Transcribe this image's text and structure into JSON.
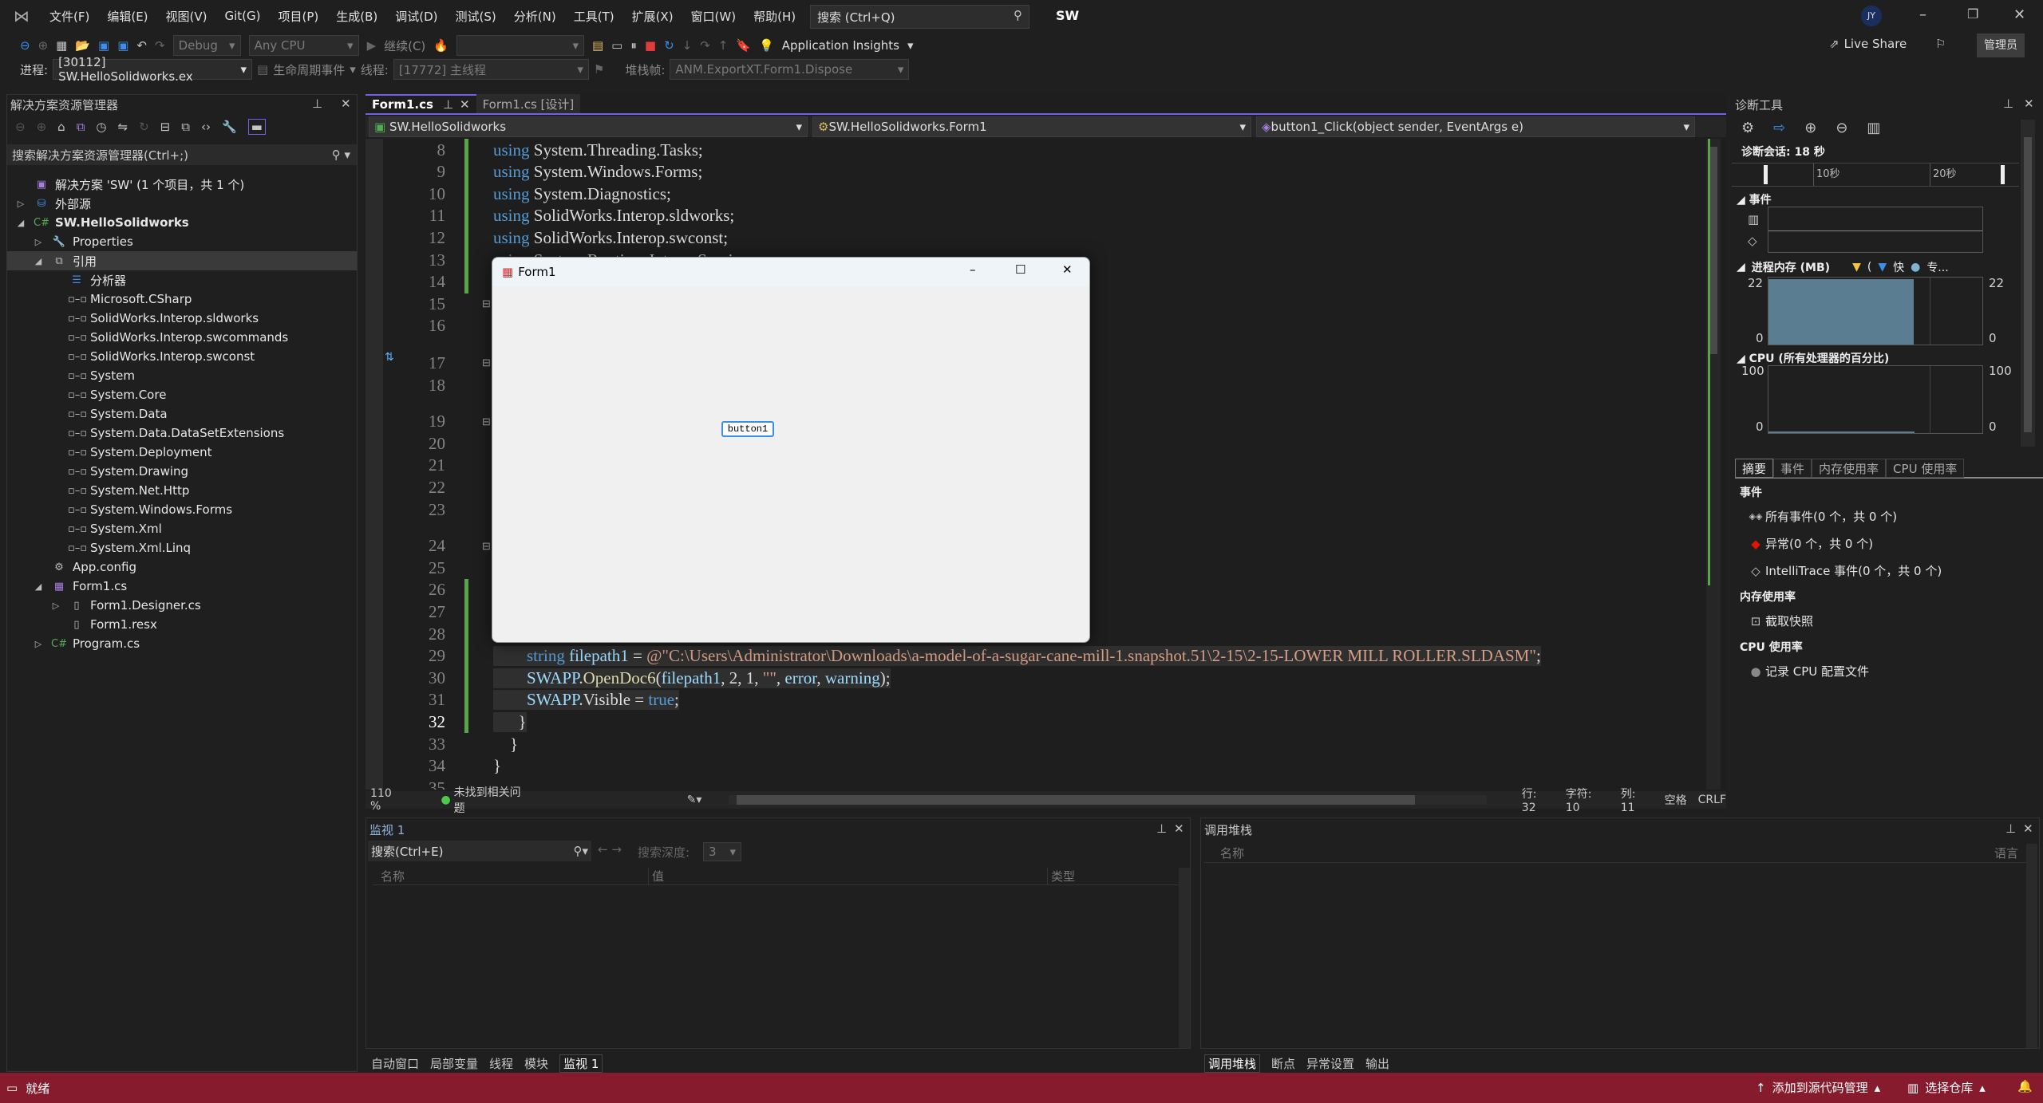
{
  "titlebar": {
    "menus": [
      "文件(F)",
      "编辑(E)",
      "视图(V)",
      "Git(G)",
      "项目(P)",
      "生成(B)",
      "调试(D)",
      "测试(S)",
      "分析(N)",
      "工具(T)",
      "扩展(X)",
      "窗口(W)",
      "帮助(H)"
    ],
    "search_placeholder": "搜索 (Ctrl+Q)",
    "solution_name": "SW",
    "avatar": "JY"
  },
  "toolbar": {
    "config": "Debug",
    "platform": "Any CPU",
    "continue": "继续(C)",
    "app_insights": "Application Insights",
    "live_share": "Live Share",
    "admin": "管理员",
    "process_label": "进程:",
    "process": "[30112] SW.HelloSolidworks.ex",
    "lifecycle": "生命周期事件",
    "thread_label": "线程:",
    "thread": "[17772] 主线程",
    "stackframe_label": "堆栈帧:",
    "stackframe": "ANM.ExportXT.Form1.Dispose"
  },
  "solution_explorer": {
    "title": "解决方案资源管理器",
    "search_placeholder": "搜索解决方案资源管理器(Ctrl+;)",
    "items": [
      {
        "label": "解决方案 'SW' (1 个项目，共 1 个)",
        "level": 0,
        "icon": "solution-icon",
        "expander": ""
      },
      {
        "label": "外部源",
        "level": 0,
        "icon": "external-sources-icon",
        "expander": "collapsed"
      },
      {
        "label": "SW.HelloSolidworks",
        "level": 0,
        "icon": "csharp-project-icon",
        "expander": "expanded",
        "bold": true
      },
      {
        "label": "Properties",
        "level": 1,
        "icon": "wrench-icon",
        "expander": "collapsed"
      },
      {
        "label": "引用",
        "level": 1,
        "icon": "references-icon",
        "expander": "expanded",
        "selected": true
      },
      {
        "label": "分析器",
        "level": 2,
        "icon": "analyzer-icon",
        "expander": ""
      },
      {
        "label": "Microsoft.CSharp",
        "level": 2,
        "icon": "reference-icon",
        "expander": ""
      },
      {
        "label": "SolidWorks.Interop.sldworks",
        "level": 2,
        "icon": "reference-icon",
        "expander": ""
      },
      {
        "label": "SolidWorks.Interop.swcommands",
        "level": 2,
        "icon": "reference-icon",
        "expander": ""
      },
      {
        "label": "SolidWorks.Interop.swconst",
        "level": 2,
        "icon": "reference-icon",
        "expander": ""
      },
      {
        "label": "System",
        "level": 2,
        "icon": "reference-icon",
        "expander": ""
      },
      {
        "label": "System.Core",
        "level": 2,
        "icon": "reference-icon",
        "expander": ""
      },
      {
        "label": "System.Data",
        "level": 2,
        "icon": "reference-icon",
        "expander": ""
      },
      {
        "label": "System.Data.DataSetExtensions",
        "level": 2,
        "icon": "reference-icon",
        "expander": ""
      },
      {
        "label": "System.Deployment",
        "level": 2,
        "icon": "reference-icon",
        "expander": ""
      },
      {
        "label": "System.Drawing",
        "level": 2,
        "icon": "reference-icon",
        "expander": ""
      },
      {
        "label": "System.Net.Http",
        "level": 2,
        "icon": "reference-icon",
        "expander": ""
      },
      {
        "label": "System.Windows.Forms",
        "level": 2,
        "icon": "reference-icon",
        "expander": ""
      },
      {
        "label": "System.Xml",
        "level": 2,
        "icon": "reference-icon",
        "expander": ""
      },
      {
        "label": "System.Xml.Linq",
        "level": 2,
        "icon": "reference-icon",
        "expander": ""
      },
      {
        "label": "App.config",
        "level": 1,
        "icon": "config-icon",
        "expander": ""
      },
      {
        "label": "Form1.cs",
        "level": 1,
        "icon": "form-icon",
        "expander": "expanded"
      },
      {
        "label": "Form1.Designer.cs",
        "level": 2,
        "icon": "file-icon",
        "expander": "collapsed"
      },
      {
        "label": "Form1.resx",
        "level": 2,
        "icon": "file-icon",
        "expander": ""
      },
      {
        "label": "Program.cs",
        "level": 1,
        "icon": "csharp-file-icon",
        "expander": "collapsed"
      }
    ]
  },
  "editor": {
    "tabs": [
      {
        "label": "Form1.cs",
        "active": true
      },
      {
        "label": "Form1.cs [设计]",
        "active": false
      }
    ],
    "nav": {
      "project": "SW.HelloSolidworks",
      "class": "SW.HelloSolidworks.Form1",
      "member": "button1_Click(object sender, EventArgs e)"
    },
    "lines": [
      {
        "n": 8,
        "tokens": [
          {
            "t": "using",
            "c": "kw"
          },
          {
            "t": " System.Threading.Tasks;",
            "c": "id"
          }
        ]
      },
      {
        "n": 9,
        "tokens": [
          {
            "t": "using",
            "c": "kw"
          },
          {
            "t": " System.Windows.Forms;",
            "c": "id"
          }
        ]
      },
      {
        "n": 10,
        "tokens": [
          {
            "t": "using",
            "c": "kw"
          },
          {
            "t": " System.Diagnostics;",
            "c": "id"
          }
        ]
      },
      {
        "n": 11,
        "tokens": [
          {
            "t": "using",
            "c": "kw"
          },
          {
            "t": " SolidWorks.Interop.sldworks;",
            "c": "id"
          }
        ]
      },
      {
        "n": 12,
        "tokens": [
          {
            "t": "using",
            "c": "kw"
          },
          {
            "t": " SolidWorks.Interop.swconst;",
            "c": "id"
          }
        ]
      },
      {
        "n": 13,
        "tokens": [
          {
            "t": "using",
            "c": "kw"
          },
          {
            "t": " System.Runtime.InteropServices;",
            "c": "id"
          }
        ]
      },
      {
        "n": 14,
        "tokens": []
      },
      {
        "n": 15,
        "tokens": []
      },
      {
        "n": 16,
        "tokens": []
      },
      {
        "n": 17,
        "tokens": []
      },
      {
        "n": 18,
        "tokens": []
      },
      {
        "n": 19,
        "tokens": []
      },
      {
        "n": 20,
        "tokens": []
      },
      {
        "n": 21,
        "tokens": []
      },
      {
        "n": 22,
        "tokens": []
      },
      {
        "n": 23,
        "tokens": []
      },
      {
        "n": 24,
        "tokens": []
      },
      {
        "n": 25,
        "tokens": []
      },
      {
        "n": 26,
        "tokens": []
      },
      {
        "n": 27,
        "tokens": []
      },
      {
        "n": 28,
        "tokens": []
      },
      {
        "n": 29,
        "tokens": [
          {
            "t": "        string",
            "c": "kw"
          },
          {
            "t": " filepath1",
            "c": "var"
          },
          {
            "t": " = ",
            "c": "pn"
          },
          {
            "t": "@\"C:\\Users\\Administrator\\Downloads\\a-model-of-a-sugar-cane-mill-1.snapshot.51\\2-15\\2-15-LOWER MILL ROLLER.SLDASM\"",
            "c": "str"
          },
          {
            "t": ";",
            "c": "pn"
          }
        ]
      },
      {
        "n": 30,
        "tokens": [
          {
            "t": "        SWAPP",
            "c": "var"
          },
          {
            "t": ".",
            "c": "pn"
          },
          {
            "t": "OpenDoc6",
            "c": "fn"
          },
          {
            "t": "(",
            "c": "pn"
          },
          {
            "t": "filepath1",
            "c": "var"
          },
          {
            "t": ", 2, 1, ",
            "c": "pn"
          },
          {
            "t": "\"\"",
            "c": "str"
          },
          {
            "t": ", ",
            "c": "pn"
          },
          {
            "t": "error",
            "c": "var"
          },
          {
            "t": ", ",
            "c": "pn"
          },
          {
            "t": "warning",
            "c": "var"
          },
          {
            "t": ");",
            "c": "pn"
          }
        ]
      },
      {
        "n": 31,
        "tokens": [
          {
            "t": "        SWAPP",
            "c": "var"
          },
          {
            "t": ".Visible = ",
            "c": "pn"
          },
          {
            "t": "true",
            "c": "kw"
          },
          {
            "t": ";",
            "c": "pn"
          }
        ]
      },
      {
        "n": 32,
        "tokens": [
          {
            "t": "      }",
            "c": "pn"
          }
        ]
      },
      {
        "n": 33,
        "tokens": [
          {
            "t": "    }",
            "c": "pn"
          }
        ]
      },
      {
        "n": 34,
        "tokens": [
          {
            "t": "}",
            "c": "pn"
          }
        ]
      },
      {
        "n": 35,
        "tokens": []
      }
    ],
    "current_line": 32,
    "status": {
      "zoom": "110 %",
      "issues": "未找到相关问题",
      "line": "行: 32",
      "char": "字符: 10",
      "col": "列: 11",
      "spaces": "空格",
      "eol": "CRLF"
    }
  },
  "form1": {
    "title": "Form1",
    "button": "button1"
  },
  "diagnostics": {
    "title": "诊断工具",
    "session": "诊断会话: 18 秒",
    "ticks": [
      "10秒",
      "20秒"
    ],
    "events_section": "事件",
    "memory_section": "进程内存 (MB)",
    "memory_legend": [
      "(",
      "快",
      "专..."
    ],
    "memory_max": "22",
    "memory_min": "0",
    "memory_value_mb": 21.5,
    "cpu_section": "CPU (所有处理器的百分比)",
    "cpu_max": "100",
    "cpu_min": "0",
    "tabs": [
      "摘要",
      "事件",
      "内存使用率",
      "CPU 使用率"
    ],
    "summary": {
      "events_header": "事件",
      "all_events": "所有事件(0 个，共 0 个)",
      "exceptions": "异常(0 个，共 0 个)",
      "intellitrace": "IntelliTrace 事件(0 个，共 0 个)",
      "memory_header": "内存使用率",
      "snapshot": "截取快照",
      "cpu_header": "CPU 使用率",
      "record_cpu": "记录 CPU 配置文件"
    }
  },
  "watch": {
    "title": "监视 1",
    "search_placeholder": "搜索(Ctrl+E)",
    "depth_label": "搜索深度:",
    "depth": "3",
    "columns": [
      "名称",
      "值",
      "类型"
    ],
    "tabs": [
      "自动窗口",
      "局部变量",
      "线程",
      "模块",
      "监视 1"
    ]
  },
  "callstack": {
    "title": "调用堆栈",
    "columns": [
      "名称",
      "语言"
    ],
    "tabs": [
      "调用堆栈",
      "断点",
      "异常设置",
      "输出"
    ]
  },
  "statusbar": {
    "ready": "就绪",
    "source_control": "添加到源代码管理",
    "repo": "选择仓库"
  },
  "colors": {
    "accent": "#7160e8",
    "statusbar": "#861b2d",
    "keyword": "#569cd6",
    "string": "#d69d85",
    "changed": "#57a64a"
  }
}
